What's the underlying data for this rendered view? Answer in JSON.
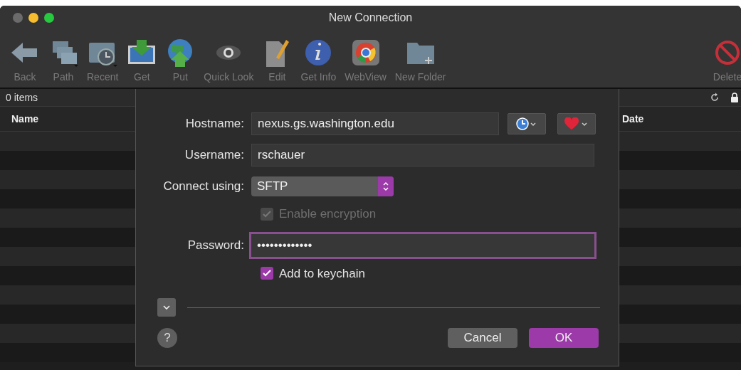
{
  "window": {
    "title": "New Connection"
  },
  "toolbar": [
    {
      "label": "Back"
    },
    {
      "label": "Path"
    },
    {
      "label": "Recent"
    },
    {
      "label": "Get"
    },
    {
      "label": "Put"
    },
    {
      "label": "Quick Look"
    },
    {
      "label": "Edit"
    },
    {
      "label": "Get Info"
    },
    {
      "label": "WebView"
    },
    {
      "label": "New Folder"
    },
    {
      "label": "Delete"
    }
  ],
  "browser": {
    "item_count": "0 items",
    "columns": [
      "Name",
      "Date"
    ]
  },
  "dialog": {
    "hostname": {
      "label": "Hostname:",
      "value": "nexus.gs.washington.edu"
    },
    "username": {
      "label": "Username:",
      "value": "rschauer"
    },
    "connect": {
      "label": "Connect using:",
      "value": "SFTP"
    },
    "encryption": {
      "label": "Enable encryption",
      "checked": true,
      "disabled": true
    },
    "password": {
      "label": "Password:",
      "value": "•••••••••••••",
      "focused": true
    },
    "keychain": {
      "label": "Add to keychain",
      "checked": true,
      "disabled": false
    },
    "help_button": "?",
    "buttons": [
      {
        "label": "Cancel",
        "primary": false
      },
      {
        "label": "OK",
        "primary": true
      }
    ]
  }
}
